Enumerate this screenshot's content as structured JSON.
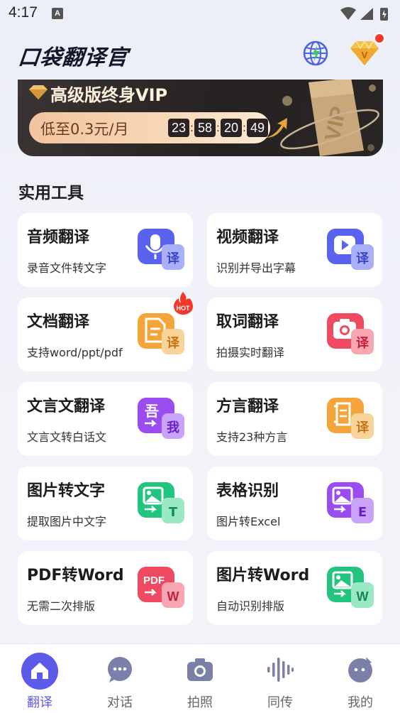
{
  "status_bar": {
    "time": "4:17",
    "notification_letter": "A"
  },
  "header": {
    "title": "口袋翻译官"
  },
  "vip_banner": {
    "title": "高级版终身VIP",
    "price": "低至0.3元/月",
    "countdown": [
      "23",
      "58",
      "20",
      "49"
    ],
    "countdown_sep": ":",
    "art_text": "VIP"
  },
  "section": {
    "title": "实用工具"
  },
  "tools": [
    {
      "title": "音频翻译",
      "subtitle": "录音文件转文字",
      "icon": "audio-translate-icon",
      "badge": "译",
      "color": "#5a63f0"
    },
    {
      "title": "视频翻译",
      "subtitle": "识别并导出字幕",
      "icon": "video-translate-icon",
      "badge": "译",
      "color": "#5a63f0"
    },
    {
      "title": "文档翻译",
      "subtitle": "支持word/ppt/pdf",
      "icon": "document-translate-icon",
      "badge": "译",
      "color": "#f5a43a"
    },
    {
      "title": "取词翻译",
      "subtitle": "拍摄实时翻译",
      "icon": "camera-translate-icon",
      "badge": "译",
      "color": "#f04a62"
    },
    {
      "title": "文言文翻译",
      "subtitle": "文言文转白话文",
      "icon": "classical-chinese-icon",
      "badge": "我",
      "glyph": "吾",
      "color": "#9a4cf0"
    },
    {
      "title": "方言翻译",
      "subtitle": "支持23种方言",
      "icon": "dialect-translate-icon",
      "badge": "译",
      "color": "#f5a43a"
    },
    {
      "title": "图片转文字",
      "subtitle": "提取图片中文字",
      "icon": "image-to-text-icon",
      "badge": "T",
      "color": "#22c47e"
    },
    {
      "title": "表格识别",
      "subtitle": "图片转Excel",
      "icon": "table-recognition-icon",
      "badge": "E",
      "color": "#9a4cf0"
    },
    {
      "title": "PDF转Word",
      "subtitle": "无需二次排版",
      "icon": "pdf-to-word-icon",
      "badge": "W",
      "glyph": "PDF",
      "color": "#f04a62"
    },
    {
      "title": "图片转Word",
      "subtitle": "自动识别排版",
      "icon": "image-to-word-icon",
      "badge": "W",
      "color": "#22c47e"
    }
  ],
  "hot_badge": "HOT",
  "bottom_nav": [
    {
      "label": "翻译",
      "active": true
    },
    {
      "label": "对话",
      "active": false
    },
    {
      "label": "拍照",
      "active": false
    },
    {
      "label": "同传",
      "active": false
    },
    {
      "label": "我的",
      "active": false
    }
  ],
  "colors": {
    "accent": "#5b5be8",
    "vip_dark": "#262222",
    "vip_gold": "#f3c49f",
    "hot": "#f2392c"
  }
}
